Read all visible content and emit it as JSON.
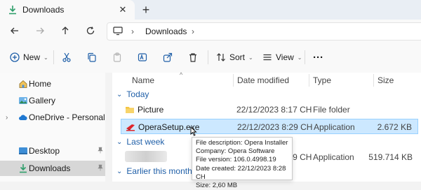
{
  "window": {
    "tab_title": "Downloads",
    "close_glyph": "✕",
    "new_tab_glyph": "+"
  },
  "nav": {
    "breadcrumb": "Downloads",
    "sep": "›"
  },
  "toolbar": {
    "new_label": "New",
    "sort_label": "Sort",
    "view_label": "View",
    "more": "···",
    "dropdown": "⌄"
  },
  "sidebar": {
    "items": [
      {
        "label": "Home",
        "icon": "home-icon"
      },
      {
        "label": "Gallery",
        "icon": "gallery-icon"
      },
      {
        "label": "OneDrive - Personal",
        "icon": "cloud-icon",
        "chevron": "›"
      },
      {
        "label": "Desktop",
        "icon": "desktop-icon",
        "pin": "📌"
      },
      {
        "label": "Downloads",
        "icon": "download-icon",
        "pin": "📌"
      }
    ]
  },
  "columns": {
    "name": "Name",
    "date": "Date modified",
    "type": "Type",
    "size": "Size",
    "sort_glyph": "^"
  },
  "groups": {
    "today": "Today",
    "last_week": "Last week",
    "earlier_month": "Earlier this month",
    "chevron": "⌄"
  },
  "rows": [
    {
      "name": "Picture",
      "date": "22/12/2023 8:17 CH",
      "type": "File folder",
      "size": ""
    },
    {
      "name": "OperaSetup.exe",
      "date": "22/12/2023 8:29 CH",
      "type": "Application",
      "size": "2.672 KB"
    },
    {
      "name": "",
      "date": "22/12/2023 8:29 CH",
      "type": "Application",
      "size": "519.714 KB"
    }
  ],
  "tooltip": {
    "l1": "File description: Opera Installer",
    "l2": "Company: Opera Software",
    "l3": "File version: 106.0.4998.19",
    "l4": "Date created: 22/12/2023 8:28 CH",
    "l5": "Size: 2,60 MB"
  },
  "colors": {
    "accent": "#1f5fa8",
    "selection": "#cce8ff",
    "opera_red": "#e0242b",
    "folder_yellow": "#f4c542",
    "download_green": "#2e9e6a"
  }
}
